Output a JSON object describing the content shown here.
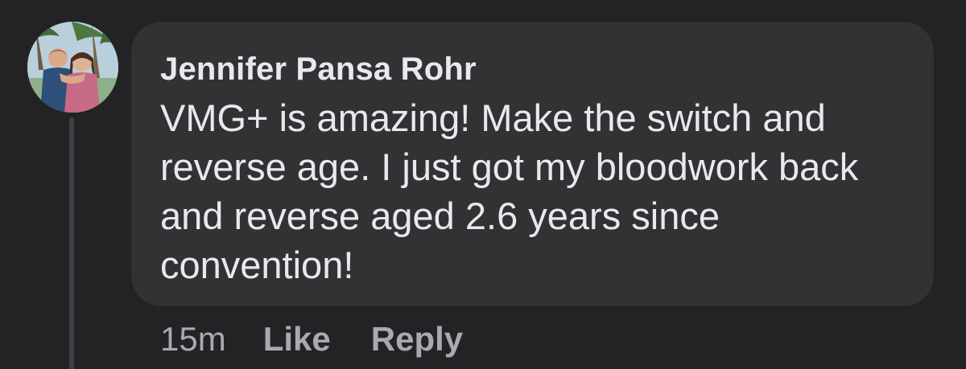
{
  "comment": {
    "author": "Jennifer Pansa Rohr",
    "text": "VMG+ is amazing! Make the switch and reverse age. I just got my bloodwork back and reverse aged 2.6 years since convention!",
    "timestamp": "15m",
    "actions": {
      "like_label": "Like",
      "reply_label": "Reply"
    }
  },
  "colors": {
    "background": "#232325",
    "bubble": "#323234",
    "text": "#e8e9ed",
    "muted": "#a8aaaf",
    "thread_line": "#3e3f42"
  }
}
